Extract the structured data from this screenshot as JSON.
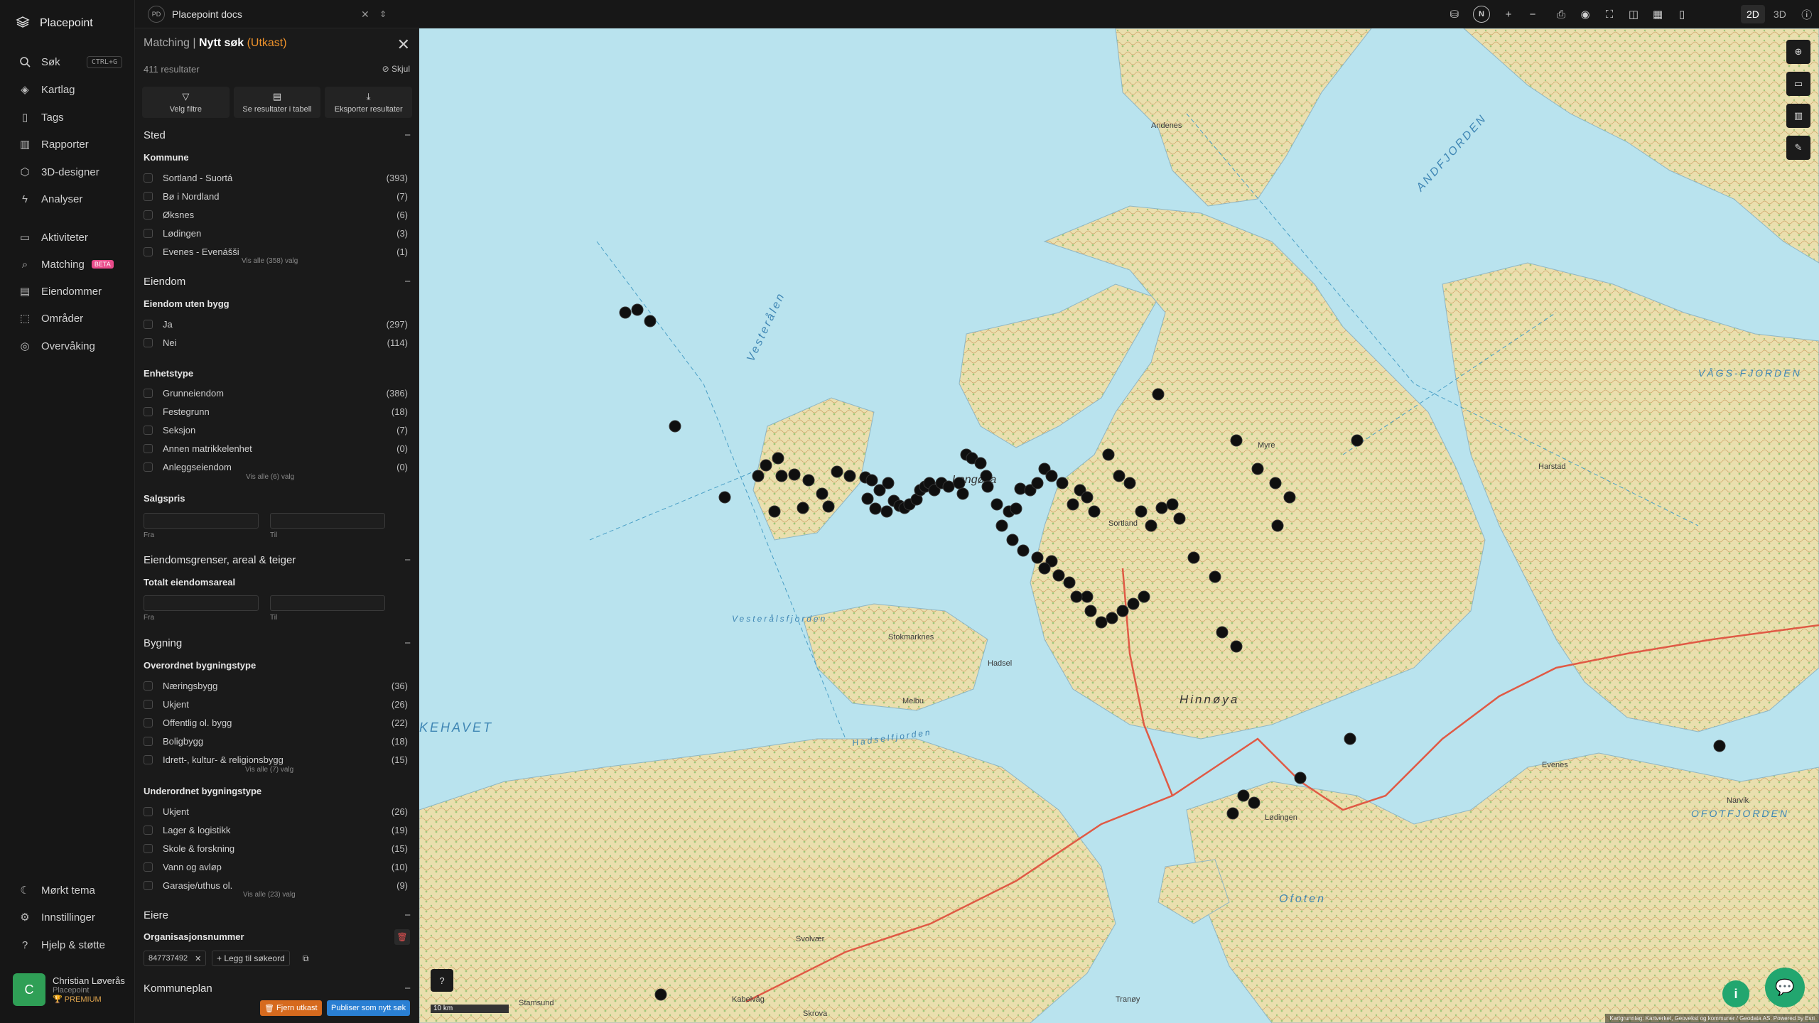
{
  "app": {
    "name": "Placepoint"
  },
  "nav": {
    "search": "Søk",
    "search_shortcut": "CTRL+G",
    "layers": "Kartlag",
    "tags": "Tags",
    "reports": "Rapporter",
    "designer": "3D-designer",
    "analyses": "Analyser",
    "activities": "Aktiviteter",
    "matching": "Matching",
    "matching_badge": "BETA",
    "properties": "Eiendommer",
    "areas": "Områder",
    "monitoring": "Overvåking",
    "dark_theme": "Mørkt tema",
    "settings": "Innstillinger",
    "help": "Hjelp & støtte"
  },
  "user": {
    "initial": "C",
    "name": "Christian Løverås",
    "org": "Placepoint",
    "plan": "PREMIUM"
  },
  "topbar": {
    "workspace_badge": "PD",
    "workspace_name": "Placepoint docs",
    "north": "N",
    "mode_2d": "2D",
    "mode_3d": "3D"
  },
  "panel": {
    "crumb": "Matching",
    "title": "Nytt søk",
    "status": "(Utkast)",
    "results": "411 resultater",
    "hide": "Skjul",
    "actions": [
      "Velg filtre",
      "Se resultater i tabell",
      "Eksporter resultater"
    ],
    "sted": {
      "title": "Sted",
      "sub": "Kommune",
      "options": [
        {
          "label": "Sortland - Suortá",
          "count": "(393)"
        },
        {
          "label": "Bø i Nordland",
          "count": "(7)"
        },
        {
          "label": "Øksnes",
          "count": "(6)"
        },
        {
          "label": "Lødingen",
          "count": "(3)"
        },
        {
          "label": "Evenes - Evenášši",
          "count": "(1)"
        }
      ],
      "more": "Vis alle (358) valg"
    },
    "eiendom": {
      "title": "Eiendom",
      "sub1": "Eiendom uten bygg",
      "opts1": [
        {
          "label": "Ja",
          "count": "(297)"
        },
        {
          "label": "Nei",
          "count": "(114)"
        }
      ],
      "sub2": "Enhetstype",
      "opts2": [
        {
          "label": "Grunneiendom",
          "count": "(386)"
        },
        {
          "label": "Festegrunn",
          "count": "(18)"
        },
        {
          "label": "Seksjon",
          "count": "(7)"
        },
        {
          "label": "Annen matrikkelenhet",
          "count": "(0)"
        },
        {
          "label": "Anleggseiendom",
          "count": "(0)"
        }
      ],
      "more": "Vis alle (6) valg",
      "sub3": "Salgspris",
      "from": "Fra",
      "to": "Til"
    },
    "grenser": {
      "title": "Eiendomsgrenser, areal & teiger",
      "sub": "Totalt eiendomsareal",
      "from": "Fra",
      "to": "Til"
    },
    "bygning": {
      "title": "Bygning",
      "sub1": "Overordnet bygningstype",
      "opts1": [
        {
          "label": "Næringsbygg",
          "count": "(36)"
        },
        {
          "label": "Ukjent",
          "count": "(26)"
        },
        {
          "label": "Offentlig ol. bygg",
          "count": "(22)"
        },
        {
          "label": "Boligbygg",
          "count": "(18)"
        },
        {
          "label": "Idrett-, kultur- & religionsbygg",
          "count": "(15)"
        }
      ],
      "more1": "Vis alle (7) valg",
      "sub2": "Underordnet bygningstype",
      "opts2": [
        {
          "label": "Ukjent",
          "count": "(26)"
        },
        {
          "label": "Lager & logistikk",
          "count": "(19)"
        },
        {
          "label": "Skole & forskning",
          "count": "(15)"
        },
        {
          "label": "Vann og avløp",
          "count": "(10)"
        },
        {
          "label": "Garasje/uthus ol.",
          "count": "(9)"
        }
      ],
      "more2": "Vis alle (23) valg"
    },
    "eiere": {
      "title": "Eiere",
      "sub": "Organisasjonsnummer",
      "tag": "847737492",
      "add": "Legg til søkeord"
    },
    "kommuneplan": {
      "title": "Kommuneplan"
    },
    "footer": {
      "remove": "Fjern utkast",
      "publish": "Publiser som nytt søk"
    }
  },
  "map": {
    "labels": {
      "vesteralen": "Vesterålen",
      "andfjorden": "ANDFJORDEN",
      "vagsfjorden": "VÅGS-FJORDEN",
      "hinnoya": "Hinnøya",
      "langoya": "Langøya",
      "ofoten": "Ofoten",
      "ofotfjorden": "OFOTFJORDEN",
      "vestfjorden": "Vesterålsfjorden",
      "havet": "KEHAVET",
      "hadselfjorden": "Hadselfjorden",
      "sortland": "Sortland",
      "harstad": "Harstad",
      "lodingen": "Lødingen",
      "stokmarknes": "Stokmarknes",
      "melbu": "Melbu",
      "svolvaer": "Svolvær",
      "myre": "Myre",
      "andenes": "Andenes",
      "kabelvag": "Kabelvåg",
      "narvik": "Narvik",
      "evenes": "Evenes",
      "skaland": "Skrova",
      "hadsel": "Hadsel",
      "stamsund": "Stamsund",
      "tranoy": "Tranøy"
    },
    "scale": "10 km",
    "attribution": "Kartgrunnlag: Kartverket, Geovekst og kommuner / Geodata AS. Powered by Esri"
  },
  "colors": {
    "accent": "#f0932b",
    "brand_green": "#22a66f",
    "publish": "#2a7fd3",
    "remove": "#d66a1e",
    "water": "#b9e3ee",
    "land": "#e8ddb0"
  }
}
